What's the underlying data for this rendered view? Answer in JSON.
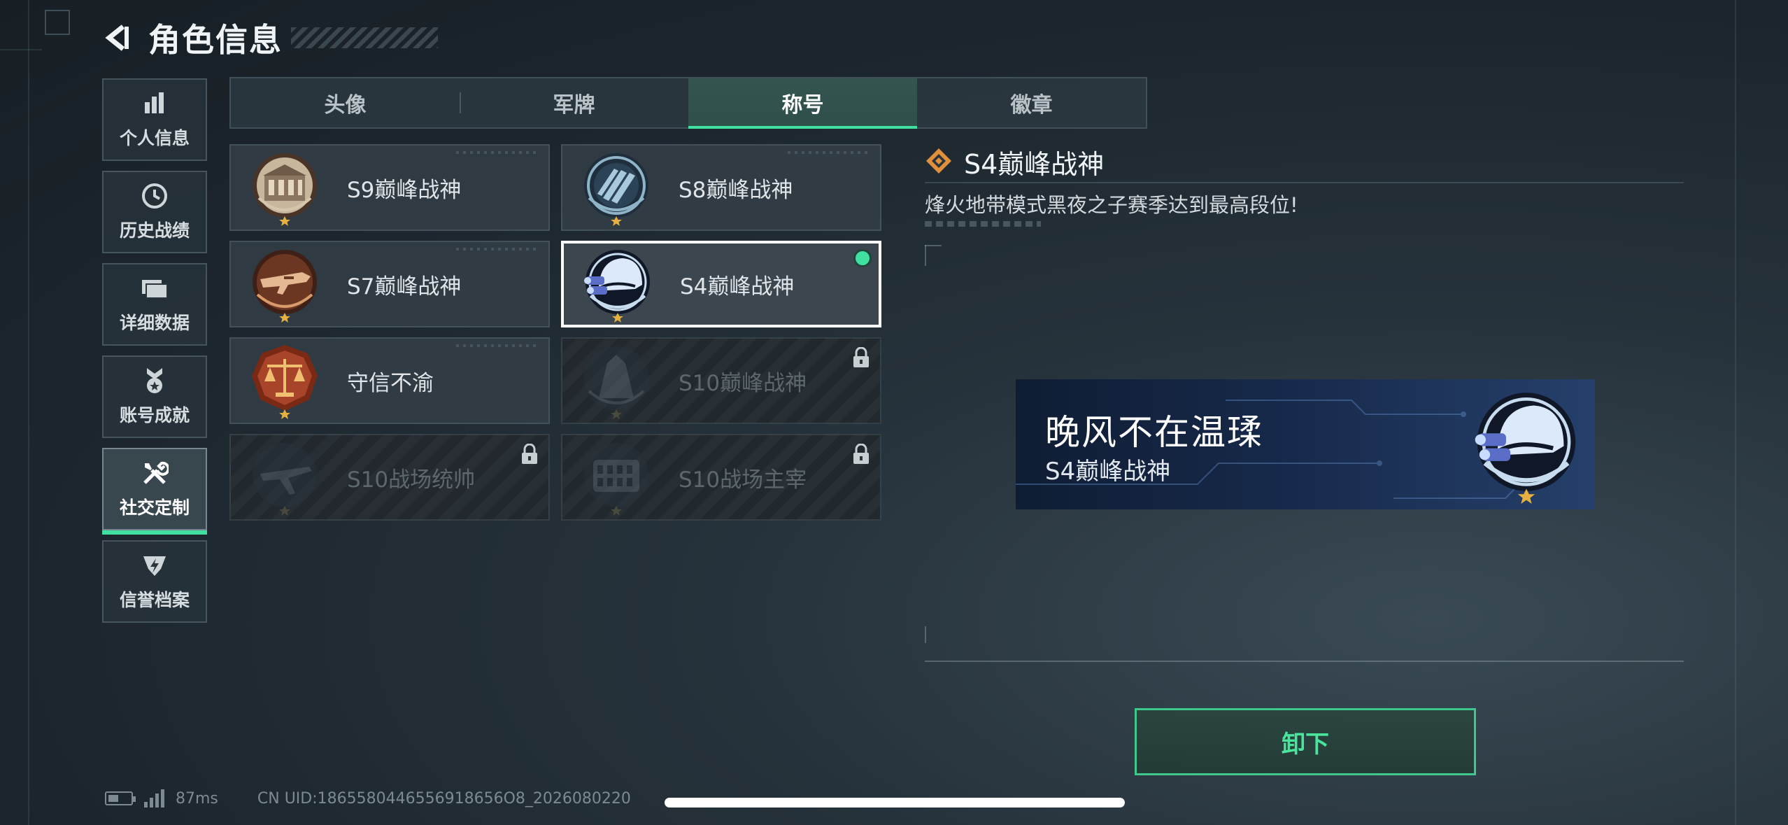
{
  "header": {
    "title": "角色信息"
  },
  "sidebar": {
    "items": [
      {
        "label": "个人信息",
        "icon": "bar-chart-icon"
      },
      {
        "label": "历史战绩",
        "icon": "clock-icon"
      },
      {
        "label": "详细数据",
        "icon": "folder-icon"
      },
      {
        "label": "账号成就",
        "icon": "achievement-icon"
      },
      {
        "label": "社交定制",
        "icon": "tools-icon",
        "active": true
      },
      {
        "label": "信誉档案",
        "icon": "shield-icon"
      }
    ]
  },
  "tabs": [
    {
      "label": "头像"
    },
    {
      "label": "军牌"
    },
    {
      "label": "称号",
      "active": true
    },
    {
      "label": "徽章"
    }
  ],
  "titles": [
    {
      "name": "S9巅峰战神",
      "medal": "building-medal-icon",
      "locked": false
    },
    {
      "name": "S8巅峰战神",
      "medal": "stripes-medal-icon",
      "locked": false
    },
    {
      "name": "S7巅峰战神",
      "medal": "weapon-medal-icon",
      "locked": false
    },
    {
      "name": "S4巅峰战神",
      "medal": "night-vision-helmet-medal-icon",
      "locked": false,
      "selected": true,
      "equipped": true
    },
    {
      "name": "守信不渝",
      "medal": "scales-medal-icon",
      "locked": false
    },
    {
      "name": "S10巅峰战神",
      "medal": "tower-medal-icon",
      "locked": true
    },
    {
      "name": "S10战场统帅",
      "medal": "aircraft-medal-icon",
      "locked": true
    },
    {
      "name": "S10战场主宰",
      "medal": "colosseum-medal-icon",
      "locked": true
    }
  ],
  "detail": {
    "title": "S4巅峰战神",
    "description": "烽火地带模式黑夜之子赛季达到最高段位!"
  },
  "nameplate": {
    "player_name": "晚风不在温瑈",
    "title": "S4巅峰战神"
  },
  "actions": {
    "unequip_label": "卸下"
  },
  "status_bar": {
    "ping": "87ms",
    "uid": "CN UID:1865580446556918656O8_2026080220"
  },
  "colors": {
    "accent_green": "#3fe0a0",
    "gold": "#e8b040",
    "medal_blue": "#9fd0ff"
  }
}
